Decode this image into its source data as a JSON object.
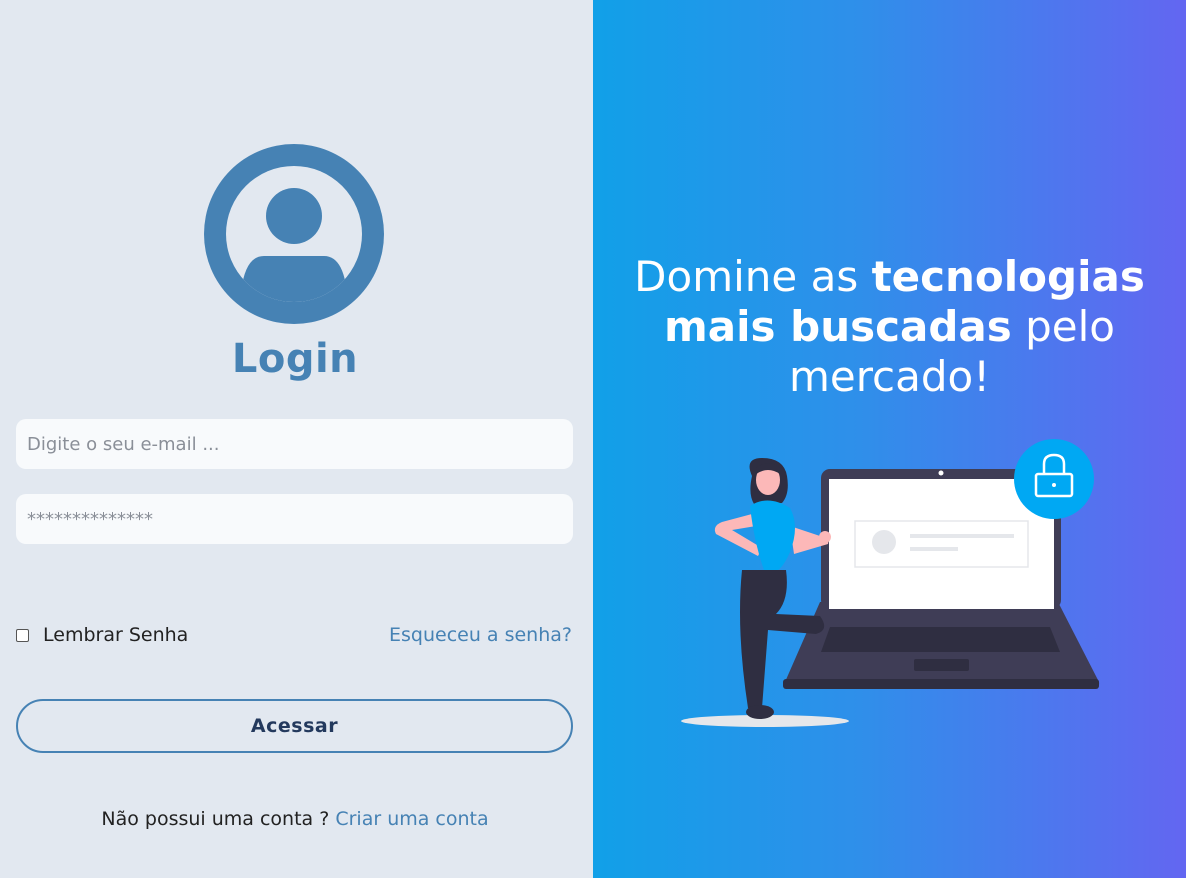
{
  "login": {
    "title": "Login",
    "email_placeholder": "Digite o seu e-mail ...",
    "password_placeholder": "**************",
    "remember_label": "Lembrar Senha",
    "forgot_link": "Esqueceu a senha?",
    "submit_button": "Acessar",
    "signup_prompt": "Não possui uma conta ?",
    "signup_link": "Criar uma conta"
  },
  "hero": {
    "line1_normal": "Domine as ",
    "line1_bold": "tecnologias",
    "line2_bold": "mais buscadas",
    "line2_normal": " pelo",
    "line3": "mercado!"
  },
  "icons": {
    "avatar": "user-avatar-icon",
    "lock": "lock-icon"
  },
  "colors": {
    "accent": "#4682b4",
    "left_bg": "#e2e8f0",
    "gradient_start": "#11a0e8",
    "gradient_end": "#6366f1"
  }
}
